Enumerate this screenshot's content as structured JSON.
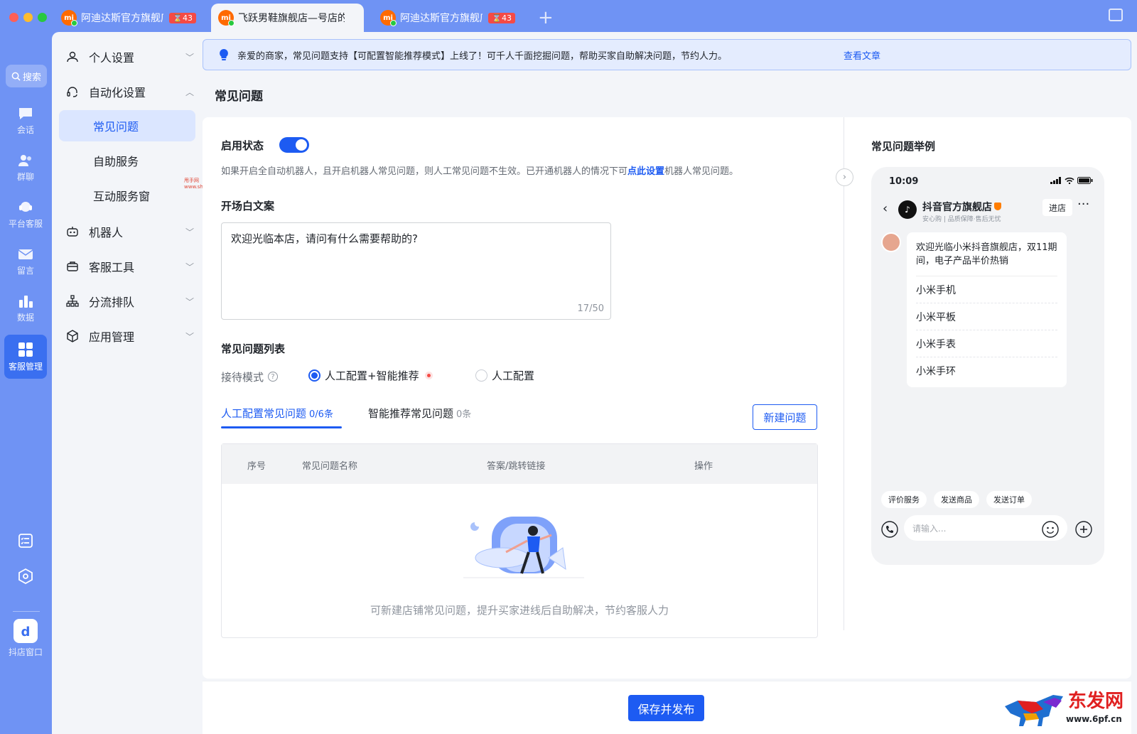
{
  "tabs": [
    {
      "logo": "mi",
      "title": "阿迪达斯官方旗舰店",
      "badge": "43",
      "active": false
    },
    {
      "logo": "mi",
      "title": "飞跃男鞋旗舰店—号店的",
      "badge": "",
      "active": true
    },
    {
      "logo": "mi",
      "title": "阿迪达斯官方旗舰店",
      "badge": "43",
      "active": false
    }
  ],
  "rail": {
    "search": "搜索",
    "items": [
      {
        "label": "会话",
        "icon": "chat-icon"
      },
      {
        "label": "群聊",
        "icon": "group-icon"
      },
      {
        "label": "平台客服",
        "icon": "headset-icon"
      },
      {
        "label": "留言",
        "icon": "mail-icon"
      },
      {
        "label": "数据",
        "icon": "bar-chart-icon"
      },
      {
        "label": "客服管理",
        "icon": "grid-icon"
      }
    ],
    "app_label": "抖店窗口"
  },
  "subnav": {
    "groups": [
      {
        "label": "个人设置",
        "icon": "user-icon"
      },
      {
        "label": "自动化设置",
        "icon": "headphone-icon"
      },
      {
        "label": "机器人",
        "icon": "robot-icon"
      },
      {
        "label": "客服工具",
        "icon": "toolbox-icon"
      },
      {
        "label": "分流排队",
        "icon": "org-tree-icon"
      },
      {
        "label": "应用管理",
        "icon": "cube-icon"
      }
    ],
    "subitems": [
      "常见问题",
      "自助服务",
      "互动服务窗"
    ]
  },
  "notice": {
    "text": "亲爱的商家，常见问题支持【可配置智能推荐模式】上线了！可千人千面挖掘问题，帮助买家自助解决问题，节约人力。",
    "link": "查看文章"
  },
  "page_title": "常见问题",
  "status": {
    "label": "启用状态",
    "enabled": true,
    "hint_before": "如果开启全自动机器人，且开启机器人常见问题，则人工常见问题不生效。已开通机器人的情况下可",
    "hint_link": "点此设置",
    "hint_after": "机器人常见问题。"
  },
  "opening": {
    "label": "开场白文案",
    "value": "欢迎光临本店，请问有什么需要帮助的?",
    "count": "17/50"
  },
  "faq_list": {
    "label": "常见问题列表",
    "mode_label": "接待模式",
    "mode_options": [
      "人工配置+智能推荐",
      "人工配置"
    ],
    "selected_mode": "人工配置+智能推荐",
    "tabs": [
      {
        "label": "人工配置常见问题",
        "count": "0/6条"
      },
      {
        "label": "智能推荐常见问题",
        "count": "0条"
      }
    ],
    "new_button": "新建问题",
    "columns": [
      "序号",
      "常见问题名称",
      "答案/跳转链接",
      "操作"
    ],
    "empty_text": "可新建店铺常见问题，提升买家进线后自助解决，节约客服人力"
  },
  "save_button": "保存并发布",
  "preview": {
    "title": "常见问题举例",
    "time": "10:09",
    "shop_name": "抖音官方旗舰店",
    "shop_sub": "安心购 | 品质保障·售后无忧",
    "enter_button": "进店",
    "greeting": "欢迎光临小米抖音旗舰店，双11期间，电子产品半价热销",
    "items": [
      "小米手机",
      "小米平板",
      "小米手表",
      "小米手环"
    ],
    "quick_actions": [
      "评价服务",
      "发送商品",
      "发送订单"
    ],
    "input_placeholder": "请输入..."
  },
  "watermarks": {
    "small_name": "甩手网",
    "small_url": "www.shuaishou.com",
    "brand": "东发网",
    "brand_url": "www.6pf.cn"
  },
  "colors": {
    "accent": "#1d5bf2",
    "rail": "#6f93f4",
    "badge": "#f54a45"
  }
}
